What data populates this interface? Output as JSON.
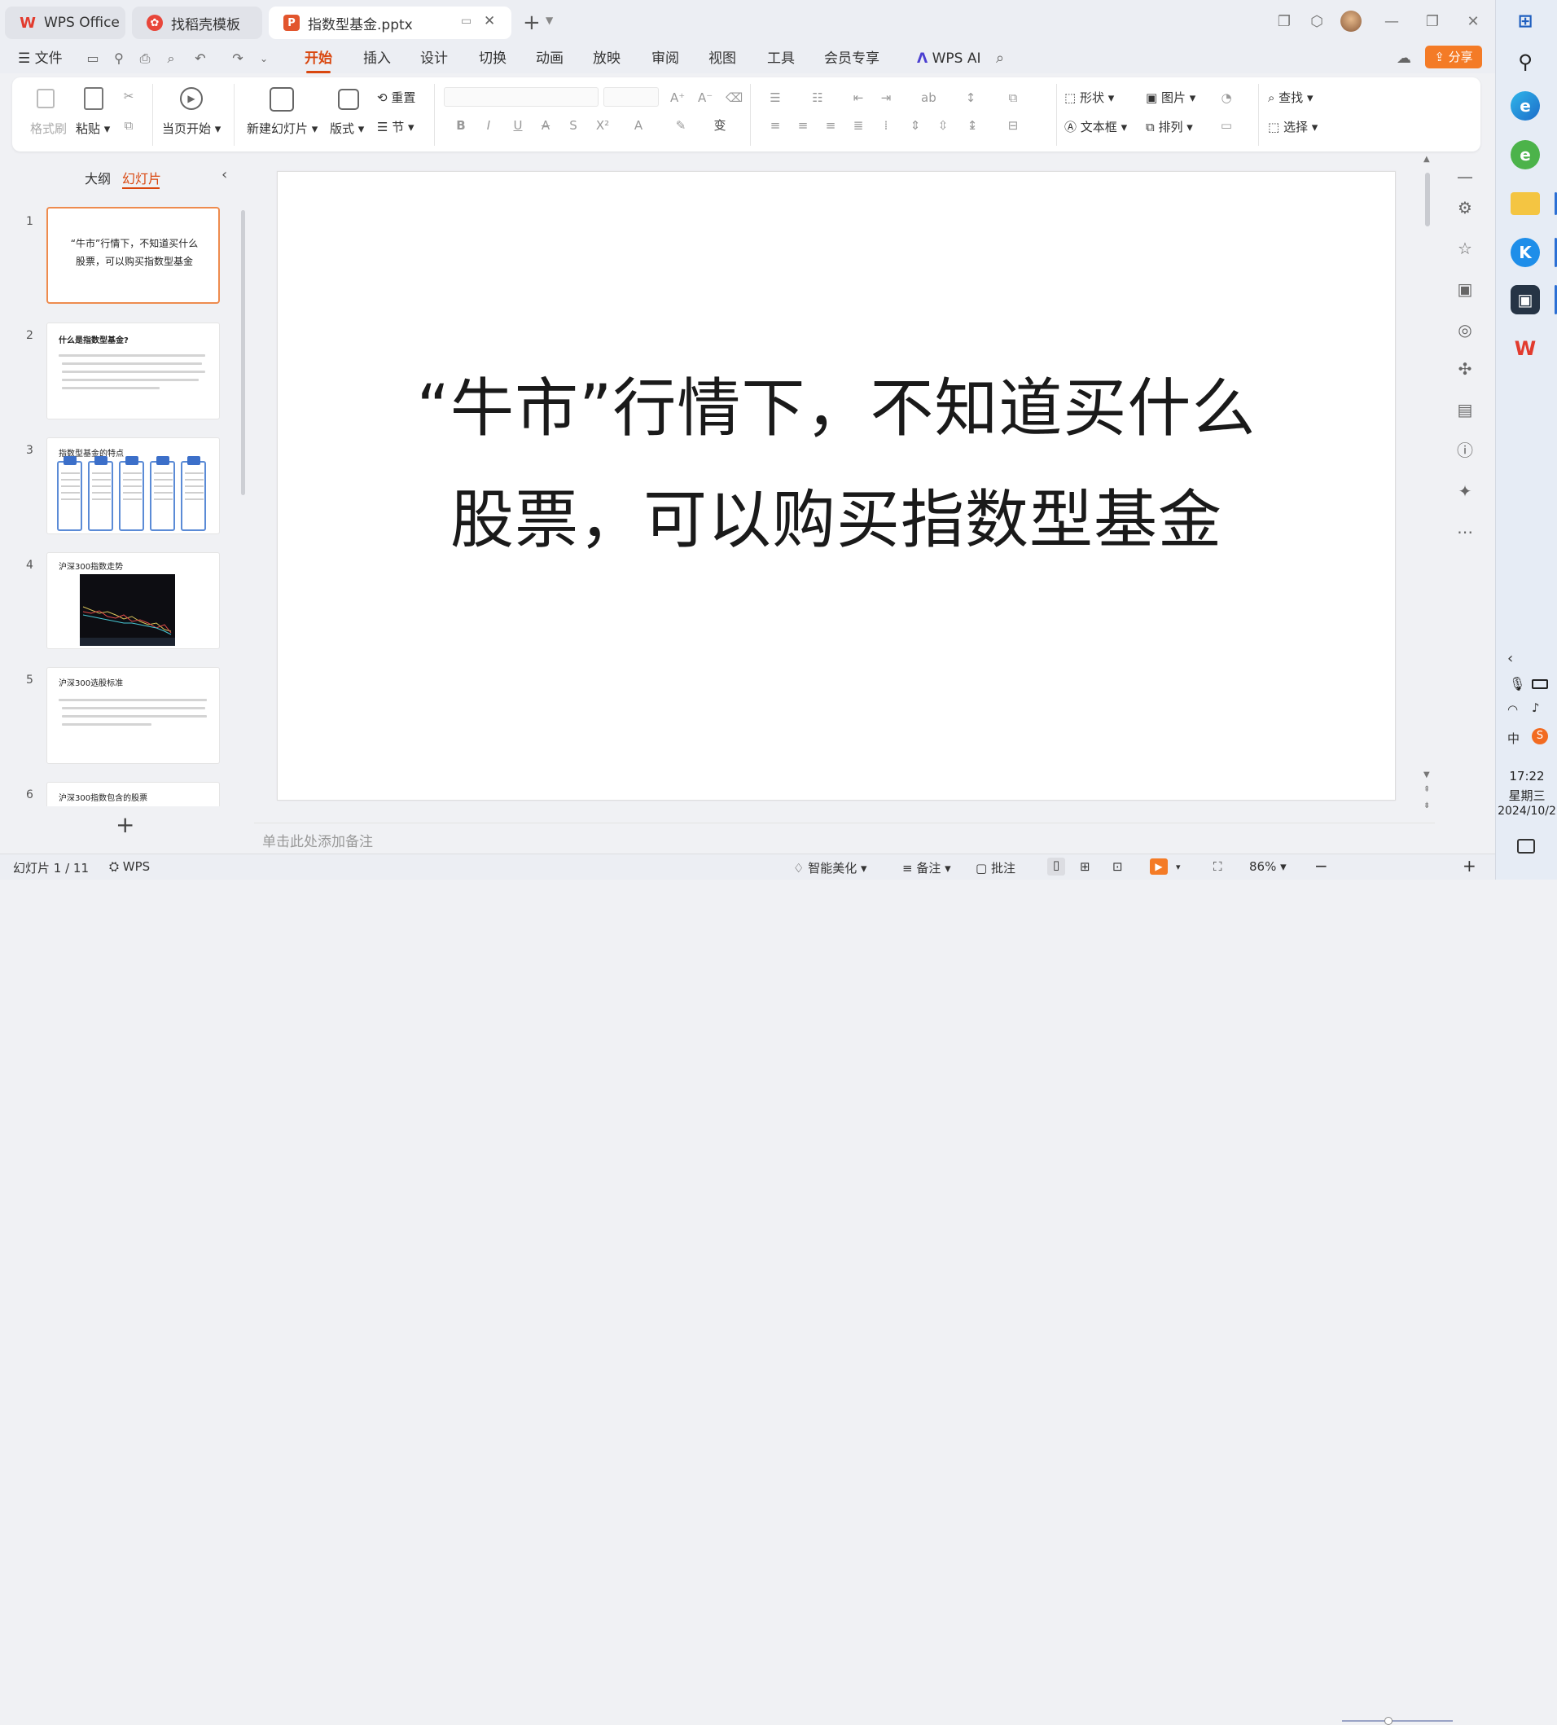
{
  "tabs": [
    {
      "label": "WPS Office"
    },
    {
      "label": "找稻壳模板"
    },
    {
      "label": "指数型基金.pptx"
    }
  ],
  "menubar": {
    "file": "文件",
    "items": [
      "开始",
      "插入",
      "设计",
      "切换",
      "动画",
      "放映",
      "审阅",
      "视图",
      "工具",
      "会员专享"
    ],
    "ai": "WPS AI",
    "share": "分享"
  },
  "ribbon": {
    "format_painter": "格式刷",
    "paste": "粘贴",
    "from_current": "当页开始",
    "new_slide": "新建幻灯片",
    "layout": "版式",
    "reset": "重置",
    "section": "节",
    "shape": "形状",
    "picture": "图片",
    "textbox": "文本框",
    "arrange": "排列",
    "find": "查找",
    "select": "选择"
  },
  "left_panel": {
    "outline_tab": "大纲",
    "slides_tab": "幻灯片"
  },
  "thumbnails": [
    {
      "num": "1",
      "text": "“牛市”行情下，不知道买什么股票，可以购买指数型基金"
    },
    {
      "num": "2",
      "title": "什么是指数型基金?"
    },
    {
      "num": "3",
      "title": "指数型基金的特点"
    },
    {
      "num": "4",
      "title": "沪深300指数走势"
    },
    {
      "num": "5",
      "title": "沪深300选股标准"
    },
    {
      "num": "6",
      "title": "沪深300指数包含的股票"
    }
  ],
  "slide": {
    "line1": "“牛市”行情下，不知道买什么",
    "line2": "股票，可以购买指数型基金"
  },
  "notes_placeholder": "单击此处添加备注",
  "status": {
    "slide_counter": "幻灯片 1 / 11",
    "theme": "WPS",
    "beautify": "智能美化",
    "notes": "备注",
    "comments": "批注",
    "zoom": "86%"
  },
  "taskbar": {
    "time": "17:22",
    "weekday": "星期三",
    "date": "2024/10/2"
  }
}
